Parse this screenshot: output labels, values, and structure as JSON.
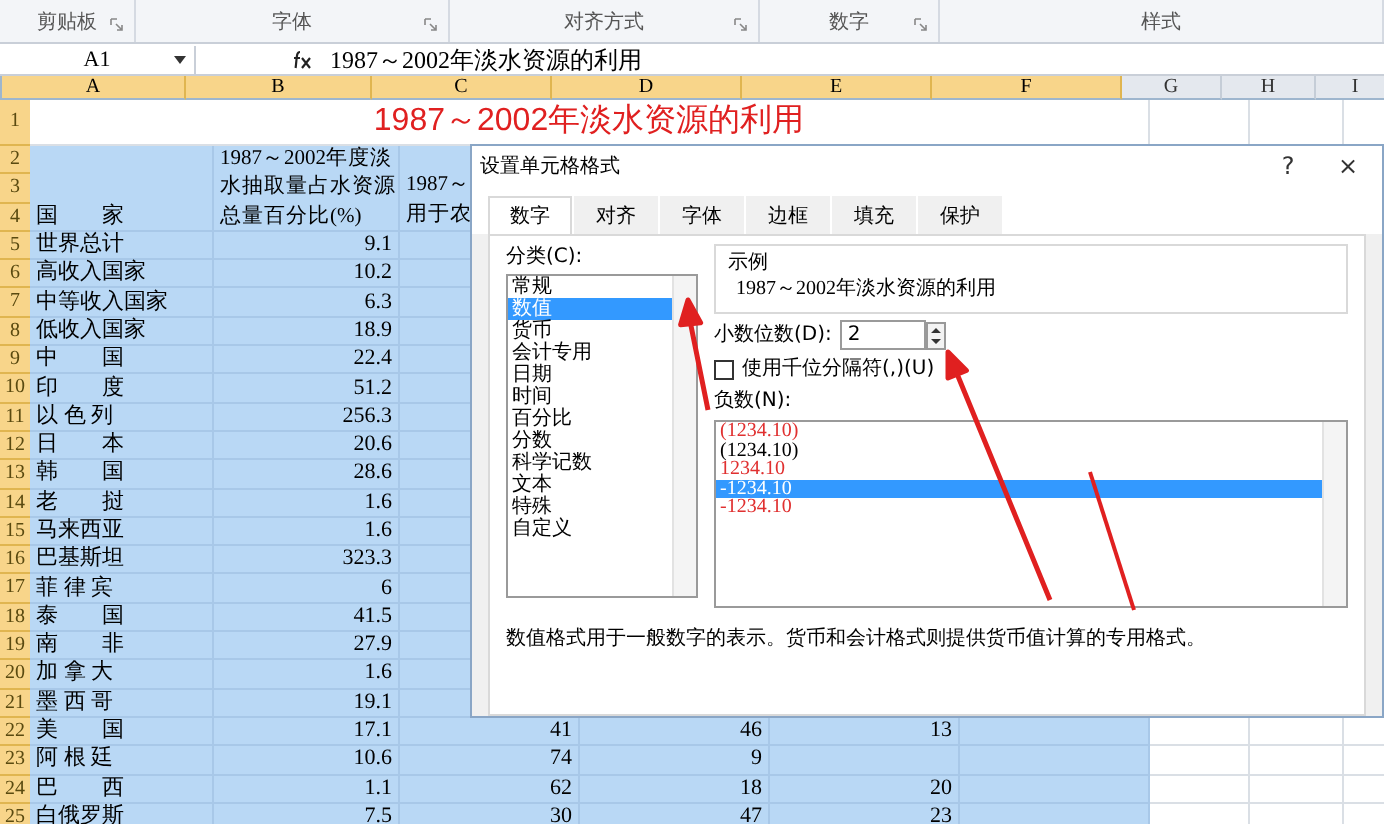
{
  "ribbon": {
    "groups": [
      {
        "label": "剪贴板",
        "launcher": true
      },
      {
        "label": "字体",
        "launcher": true
      },
      {
        "label": "对齐方式",
        "launcher": true
      },
      {
        "label": "数字",
        "launcher": true
      },
      {
        "label": "样式",
        "launcher": false
      }
    ]
  },
  "formula_bar": {
    "name_box": "A1",
    "formula": "1987～2002年淡水资源的利用"
  },
  "sheet": {
    "columns": [
      {
        "label": "A",
        "selected": true
      },
      {
        "label": "B",
        "selected": true
      },
      {
        "label": "C",
        "selected": true
      },
      {
        "label": "D",
        "selected": true
      },
      {
        "label": "E",
        "selected": true
      },
      {
        "label": "F",
        "selected": true
      },
      {
        "label": "G",
        "selected": false
      },
      {
        "label": "H",
        "selected": false
      },
      {
        "label": "I",
        "selected": false
      }
    ],
    "row_numbers": [
      {
        "label": "1",
        "selected": true
      },
      {
        "label": "2",
        "selected": true
      },
      {
        "label": "3",
        "selected": true
      },
      {
        "label": "4",
        "selected": true
      },
      {
        "label": "5",
        "selected": true
      },
      {
        "label": "6",
        "selected": true
      },
      {
        "label": "7",
        "selected": true
      },
      {
        "label": "8",
        "selected": true
      },
      {
        "label": "9",
        "selected": true
      },
      {
        "label": "10",
        "selected": true
      },
      {
        "label": "11",
        "selected": true
      },
      {
        "label": "12",
        "selected": true
      },
      {
        "label": "13",
        "selected": true
      },
      {
        "label": "14",
        "selected": true
      },
      {
        "label": "15",
        "selected": true
      },
      {
        "label": "16",
        "selected": true
      },
      {
        "label": "17",
        "selected": true
      },
      {
        "label": "18",
        "selected": true
      },
      {
        "label": "19",
        "selected": true
      },
      {
        "label": "20",
        "selected": true
      },
      {
        "label": "21",
        "selected": true
      },
      {
        "label": "22",
        "selected": true
      },
      {
        "label": "23",
        "selected": true
      },
      {
        "label": "24",
        "selected": true
      },
      {
        "label": "25",
        "selected": true
      }
    ],
    "title": "1987～2002年淡水资源的利用",
    "header": {
      "country": "国　　家",
      "column_b": [
        "1987～2002年度淡",
        "水抽取量占水资源",
        "总量百分比(%)"
      ],
      "column_c": [
        "1987～",
        "用于农"
      ]
    },
    "rows": [
      {
        "country": "世界总计",
        "b": "9.1"
      },
      {
        "country": "高收入国家",
        "b": "10.2"
      },
      {
        "country": "中等收入国家",
        "b": "6.3"
      },
      {
        "country": "低收入国家",
        "b": "18.9"
      },
      {
        "country": "中　　国",
        "b": "22.4"
      },
      {
        "country": "印　　度",
        "b": "51.2"
      },
      {
        "country": "以 色 列",
        "b": "256.3"
      },
      {
        "country": "日　　本",
        "b": "20.6"
      },
      {
        "country": "韩　　国",
        "b": "28.6"
      },
      {
        "country": "老　　挝",
        "b": "1.6"
      },
      {
        "country": "马来西亚",
        "b": "1.6"
      },
      {
        "country": "巴基斯坦",
        "b": "323.3"
      },
      {
        "country": "菲 律 宾",
        "b": "6"
      },
      {
        "country": "泰　　国",
        "b": "41.5"
      },
      {
        "country": "南　　非",
        "b": "27.9"
      },
      {
        "country": "加 拿 大",
        "b": "1.6"
      },
      {
        "country": "墨 西 哥",
        "b": "19.1"
      },
      {
        "country": "美　　国",
        "b": "17.1",
        "c": "41",
        "d": "46",
        "e": "13"
      },
      {
        "country": "阿 根 廷",
        "b": "10.6",
        "c": "74",
        "d": "9"
      },
      {
        "country": "巴　　西",
        "b": "1.1",
        "c": "62",
        "d": "18",
        "e": "20"
      },
      {
        "country": "白俄罗斯",
        "b": "7.5",
        "c": "30",
        "d": "47",
        "e": "23"
      }
    ]
  },
  "dialog": {
    "title": "设置单元格格式",
    "help": "?",
    "close": "×",
    "tabs": [
      {
        "label": "数字",
        "selected": true
      },
      {
        "label": "对齐",
        "selected": false
      },
      {
        "label": "字体",
        "selected": false
      },
      {
        "label": "边框",
        "selected": false
      },
      {
        "label": "填充",
        "selected": false
      },
      {
        "label": "保护",
        "selected": false
      }
    ],
    "category_label": "分类(C):",
    "categories": [
      {
        "label": "常规",
        "selected": false
      },
      {
        "label": "数值",
        "selected": true
      },
      {
        "label": "货币",
        "selected": false
      },
      {
        "label": "会计专用",
        "selected": false
      },
      {
        "label": "日期",
        "selected": false
      },
      {
        "label": "时间",
        "selected": false
      },
      {
        "label": "百分比",
        "selected": false
      },
      {
        "label": "分数",
        "selected": false
      },
      {
        "label": "科学记数",
        "selected": false
      },
      {
        "label": "文本",
        "selected": false
      },
      {
        "label": "特殊",
        "selected": false
      },
      {
        "label": "自定义",
        "selected": false
      }
    ],
    "sample_label": "示例",
    "sample": "1987～2002年淡水资源的利用",
    "decimals_label": "小数位数(D):",
    "decimals": "2",
    "separator": {
      "label": "使用千位分隔符(,)(U)",
      "checked": false
    },
    "negative_label": "负数(N):",
    "negatives": [
      {
        "text": "(1234.10)",
        "color": "#e03030",
        "selected": false
      },
      {
        "text": "(1234.10)",
        "color": "#000000",
        "selected": false
      },
      {
        "text": "1234.10",
        "color": "#e03030",
        "selected": false
      },
      {
        "text": "-1234.10",
        "selected": true
      },
      {
        "text": "-1234.10",
        "color": "#e03030",
        "selected": false
      }
    ],
    "description": "数值格式用于一般数字的表示。货币和会计格式则提供货币值计算的专用格式。"
  }
}
